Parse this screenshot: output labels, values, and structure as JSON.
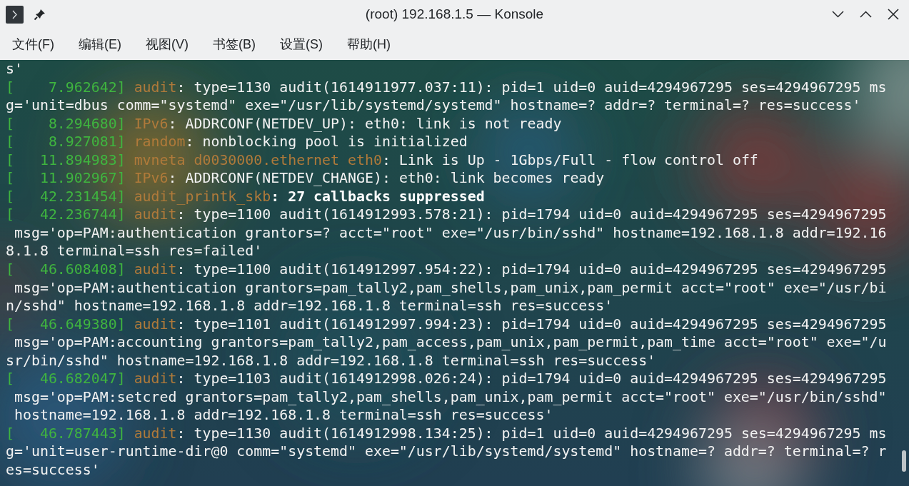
{
  "window": {
    "title": "(root) 192.168.1.5 — Konsole"
  },
  "menu": [
    "文件(F)",
    "编辑(E)",
    "视图(V)",
    "书签(B)",
    "设置(S)",
    "帮助(H)"
  ],
  "terminal": {
    "lines": [
      {
        "segments": [
          {
            "kind": "text",
            "text": "s'"
          }
        ]
      },
      {
        "segments": [
          {
            "kind": "timestamp",
            "text": "[    7.962642]"
          },
          {
            "kind": "source",
            "text": " audit"
          },
          {
            "kind": "text",
            "text": ": type=1130 audit(1614911977.037:11): pid=1 uid=0 auid=4294967295 ses=4294967295 ms"
          }
        ]
      },
      {
        "segments": [
          {
            "kind": "text",
            "text": "g='unit=dbus comm=\"systemd\" exe=\"/usr/lib/systemd/systemd\" hostname=? addr=? terminal=? res=success'"
          }
        ]
      },
      {
        "segments": [
          {
            "kind": "timestamp",
            "text": "[    8.294680]"
          },
          {
            "kind": "source",
            "text": " IPv6"
          },
          {
            "kind": "text",
            "text": ": ADDRCONF(NETDEV_UP): eth0: link is not ready"
          }
        ]
      },
      {
        "segments": [
          {
            "kind": "timestamp",
            "text": "[    8.927081]"
          },
          {
            "kind": "source",
            "text": " random"
          },
          {
            "kind": "text",
            "text": ": nonblocking pool is initialized"
          }
        ]
      },
      {
        "segments": [
          {
            "kind": "timestamp",
            "text": "[   11.894983]"
          },
          {
            "kind": "source",
            "text": " mvneta d0030000.ethernet eth0"
          },
          {
            "kind": "text",
            "text": ": Link is Up - 1Gbps/Full - flow control off"
          }
        ]
      },
      {
        "segments": [
          {
            "kind": "timestamp",
            "text": "[   11.902967]"
          },
          {
            "kind": "source",
            "text": " IPv6"
          },
          {
            "kind": "text",
            "text": ": ADDRCONF(NETDEV_CHANGE): eth0: link becomes ready"
          }
        ]
      },
      {
        "segments": [
          {
            "kind": "timestamp",
            "text": "[   42.231454]"
          },
          {
            "kind": "source",
            "text": " audit_printk_skb"
          },
          {
            "kind": "bold",
            "text": ": 27 callbacks suppressed"
          }
        ]
      },
      {
        "segments": [
          {
            "kind": "timestamp",
            "text": "[   42.236744]"
          },
          {
            "kind": "source",
            "text": " audit"
          },
          {
            "kind": "text",
            "text": ": type=1100 audit(1614912993.578:21): pid=1794 uid=0 auid=4294967295 ses=4294967295"
          }
        ]
      },
      {
        "segments": [
          {
            "kind": "text",
            "text": " msg='op=PAM:authentication grantors=? acct=\"root\" exe=\"/usr/bin/sshd\" hostname=192.168.1.8 addr=192.16"
          }
        ]
      },
      {
        "segments": [
          {
            "kind": "text",
            "text": "8.1.8 terminal=ssh res=failed'"
          }
        ]
      },
      {
        "segments": [
          {
            "kind": "timestamp",
            "text": "[   46.608408]"
          },
          {
            "kind": "source",
            "text": " audit"
          },
          {
            "kind": "text",
            "text": ": type=1100 audit(1614912997.954:22): pid=1794 uid=0 auid=4294967295 ses=4294967295"
          }
        ]
      },
      {
        "segments": [
          {
            "kind": "text",
            "text": " msg='op=PAM:authentication grantors=pam_tally2,pam_shells,pam_unix,pam_permit acct=\"root\" exe=\"/usr/bi"
          }
        ]
      },
      {
        "segments": [
          {
            "kind": "text",
            "text": "n/sshd\" hostname=192.168.1.8 addr=192.168.1.8 terminal=ssh res=success'"
          }
        ]
      },
      {
        "segments": [
          {
            "kind": "timestamp",
            "text": "[   46.649380]"
          },
          {
            "kind": "source",
            "text": " audit"
          },
          {
            "kind": "text",
            "text": ": type=1101 audit(1614912997.994:23): pid=1794 uid=0 auid=4294967295 ses=4294967295"
          }
        ]
      },
      {
        "segments": [
          {
            "kind": "text",
            "text": " msg='op=PAM:accounting grantors=pam_tally2,pam_access,pam_unix,pam_permit,pam_time acct=\"root\" exe=\"/u"
          }
        ]
      },
      {
        "segments": [
          {
            "kind": "text",
            "text": "sr/bin/sshd\" hostname=192.168.1.8 addr=192.168.1.8 terminal=ssh res=success'"
          }
        ]
      },
      {
        "segments": [
          {
            "kind": "timestamp",
            "text": "[   46.682047]"
          },
          {
            "kind": "source",
            "text": " audit"
          },
          {
            "kind": "text",
            "text": ": type=1103 audit(1614912998.026:24): pid=1794 uid=0 auid=4294967295 ses=4294967295"
          }
        ]
      },
      {
        "segments": [
          {
            "kind": "text",
            "text": " msg='op=PAM:setcred grantors=pam_tally2,pam_shells,pam_unix,pam_permit acct=\"root\" exe=\"/usr/bin/sshd\""
          }
        ]
      },
      {
        "segments": [
          {
            "kind": "text",
            "text": " hostname=192.168.1.8 addr=192.168.1.8 terminal=ssh res=success'"
          }
        ]
      },
      {
        "segments": [
          {
            "kind": "timestamp",
            "text": "[   46.787443]"
          },
          {
            "kind": "source",
            "text": " audit"
          },
          {
            "kind": "text",
            "text": ": type=1130 audit(1614912998.134:25): pid=1 uid=0 auid=4294967295 ses=4294967295 ms"
          }
        ]
      },
      {
        "segments": [
          {
            "kind": "text",
            "text": "g='unit=user-runtime-dir@0 comm=\"systemd\" exe=\"/usr/lib/systemd/systemd\" hostname=? addr=? terminal=? r"
          }
        ]
      },
      {
        "segments": [
          {
            "kind": "text",
            "text": "es=success'"
          }
        ]
      }
    ]
  }
}
